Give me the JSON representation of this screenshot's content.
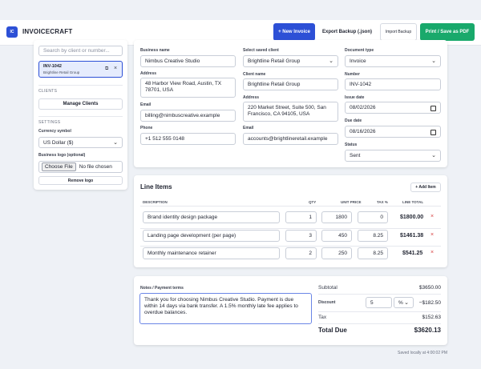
{
  "header": {
    "logo_text": "IC",
    "app_title": "INVOICECRAFT",
    "new_invoice": "+ New Invoice",
    "export_backup": "Export Backup (.json)",
    "import_backup": "Import Backup",
    "print_pdf": "Print / Save as PDF"
  },
  "sidebar": {
    "search_placeholder": "Search by client or number...",
    "invoice": {
      "number": "INV-1042",
      "client": "Brightline Retail Group"
    },
    "clients_heading": "CLIENTS",
    "manage_clients": "Manage Clients",
    "settings_heading": "SETTINGS",
    "currency_label": "Currency symbol",
    "currency_value": "US Dollar ($)",
    "logo_label": "Business logo (optional)",
    "choose_file": "Choose File",
    "no_file": "No file chosen",
    "remove_logo": "Remove logo"
  },
  "business": {
    "name_label": "Business name",
    "name": "Nimbus Creative Studio",
    "address_label": "Address",
    "address": "48 Harbor View Road, Austin, TX 78701, USA",
    "email_label": "Email",
    "email": "billing@nimbuscreative.example",
    "phone_label": "Phone",
    "phone": "+1 512 555 0148"
  },
  "client": {
    "saved_label": "Select saved client",
    "saved": "Brightline Retail Group",
    "name_label": "Client name",
    "name": "Brightline Retail Group",
    "address_label": "Address",
    "address": "220 Market Street, Suite 500, San Francisco, CA 94105, USA",
    "email_label": "Email",
    "email": "accounts@brightlineretail.example"
  },
  "doc": {
    "type_label": "Document type",
    "type": "Invoice",
    "number_label": "Number",
    "number": "INV-1042",
    "issue_label": "Issue date",
    "issue": "08/02/2026",
    "due_label": "Due date",
    "due": "08/16/2026",
    "status_label": "Status",
    "status": "Sent"
  },
  "line_items": {
    "title": "Line Items",
    "add_item": "+ Add Item",
    "headers": {
      "description": "DESCRIPTION",
      "qty": "QTY",
      "unit_price": "UNIT PRICE",
      "tax": "TAX %",
      "line_total": "LINE TOTAL"
    },
    "rows": [
      {
        "description": "Brand identity design package",
        "qty": "1",
        "unit_price": "1800",
        "tax": "0",
        "total": "$1800.00"
      },
      {
        "description": "Landing page development (per page)",
        "qty": "3",
        "unit_price": "450",
        "tax": "8.25",
        "total": "$1461.38"
      },
      {
        "description": "Monthly maintenance retainer",
        "qty": "2",
        "unit_price": "250",
        "tax": "8.25",
        "total": "$541.25"
      }
    ],
    "delete_glyph": "×"
  },
  "notes": {
    "label": "Notes / Payment terms",
    "text": "Thank you for choosing Nimbus Creative Studio. Payment is due within 14 days via bank transfer. A 1.5% monthly late fee applies to overdue balances."
  },
  "totals": {
    "subtotal_label": "Subtotal",
    "subtotal": "$3650.00",
    "discount_label": "Discount",
    "discount_value": "5",
    "discount_unit": "%",
    "discount_amount": "−$182.50",
    "tax_label": "Tax",
    "tax": "$152.63",
    "total_label": "Total Due",
    "total": "$3620.13"
  },
  "footer": {
    "saved": "Saved locally at 4:00:02 PM"
  },
  "colors": {
    "accent": "#2d50d6",
    "success": "#19a96b",
    "danger": "#d63a3a"
  }
}
